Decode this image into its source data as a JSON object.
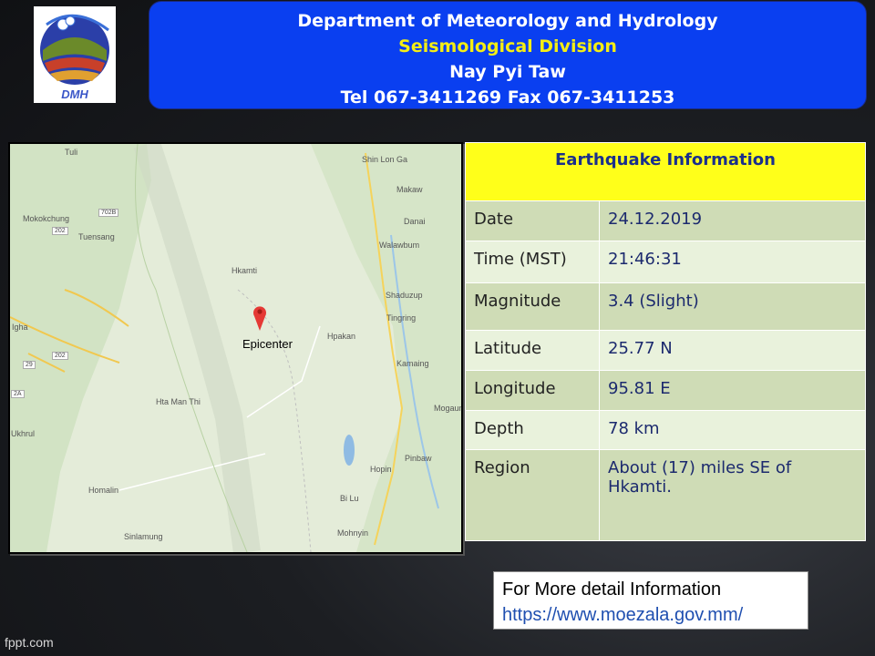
{
  "header": {
    "line1": "Department of Meteorology and Hydrology",
    "line2": "Seismological  Division",
    "line3": "Nay Pyi Taw",
    "line4": "Tel 067-3411269  Fax 067-3411253"
  },
  "logo": {
    "text": "DMH"
  },
  "map": {
    "epicenter_label": "Epicenter",
    "places": [
      {
        "name": "Tuli"
      },
      {
        "name": "Mokokchung"
      },
      {
        "name": "Tuensang"
      },
      {
        "name": "Shin Lon Ga"
      },
      {
        "name": "Makaw"
      },
      {
        "name": "Danai"
      },
      {
        "name": "Walawbum"
      },
      {
        "name": "Hkamti"
      },
      {
        "name": "Shaduzup"
      },
      {
        "name": "Tingring"
      },
      {
        "name": "Hpakan"
      },
      {
        "name": "Kamaing"
      },
      {
        "name": "Hta Man Thi"
      },
      {
        "name": "Mogaun"
      },
      {
        "name": "Ukhrul"
      },
      {
        "name": "Pinbaw"
      },
      {
        "name": "Hopin"
      },
      {
        "name": "Homalin"
      },
      {
        "name": "Bi Lu"
      },
      {
        "name": "Sinlamung"
      },
      {
        "name": "Mohnyin"
      },
      {
        "name": "Igha"
      }
    ],
    "road_shields": [
      "702B",
      "202",
      "202",
      "29",
      "2A"
    ]
  },
  "info": {
    "title": "Earthquake Information",
    "rows": [
      {
        "key": "Date",
        "value": "24.12.2019"
      },
      {
        "key": "Time (MST)",
        "value": "21:46:31"
      },
      {
        "key": "Magnitude",
        "value": "3.4 (Slight)"
      },
      {
        "key": "Latitude",
        "value": "25.77 N"
      },
      {
        "key": "Longitude",
        "value": "95.81 E"
      },
      {
        "key": "Depth",
        "value": "78 km"
      },
      {
        "key": "Region",
        "value": "About (17) miles SE of Hkamti."
      }
    ]
  },
  "more_info": {
    "label": "For More detail Information",
    "url": "https://www.moezala.gov.mm/"
  },
  "watermark": "fppt.com",
  "colors": {
    "header_bg": "#0a3ff0",
    "header_yellow": "#f4ee14",
    "table_header": "#ffff1a",
    "row_dark": "#cfdcb6",
    "row_light": "#e9f2dc",
    "pin": "#e53935"
  }
}
